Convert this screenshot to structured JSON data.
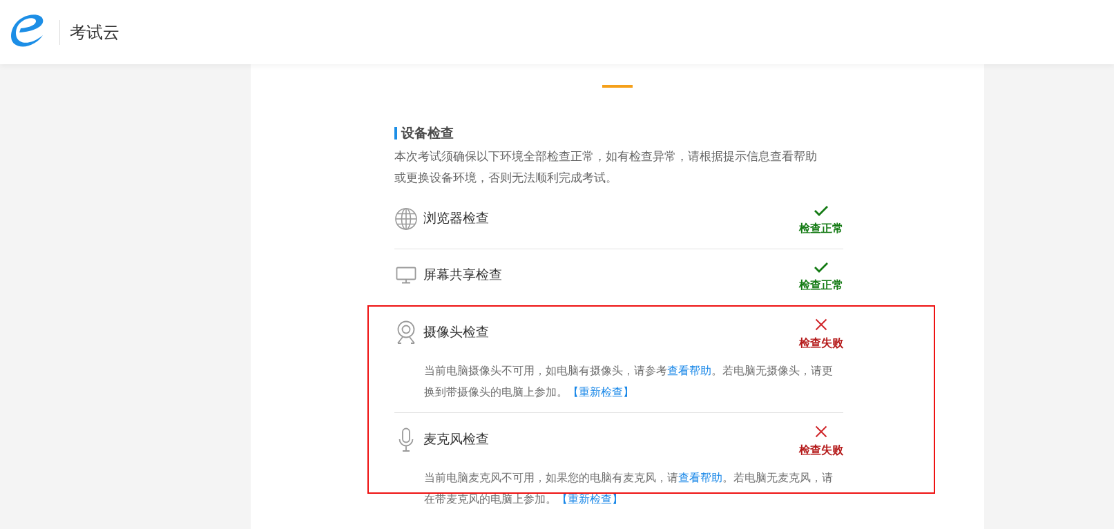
{
  "header": {
    "app_name": "考试云"
  },
  "section": {
    "title": "设备检查",
    "description": "本次考试须确保以下环境全部检查正常，如有检查异常，请根据提示信息查看帮助或更换设备环境，否则无法顺利完成考试。"
  },
  "highlight_frame": true,
  "checks": [
    {
      "kind": "browser",
      "name": "浏览器检查",
      "passed": true,
      "status_text": "检查正常"
    },
    {
      "kind": "screen",
      "name": "屏幕共享检查",
      "passed": true,
      "status_text": "检查正常"
    },
    {
      "kind": "camera",
      "name": "摄像头检查",
      "passed": false,
      "status_text": "检查失败",
      "detail": [
        {
          "kind": "text",
          "text": "当前电脑摄像头不可用，如电脑有摄像头，请参考"
        },
        {
          "kind": "link",
          "text": "查看帮助"
        },
        {
          "kind": "text",
          "text": "。若电脑无摄像头，请更换到带摄像头的电脑上参加。"
        },
        {
          "kind": "link",
          "text": "【重新检查】"
        }
      ]
    },
    {
      "kind": "microphone",
      "name": "麦克风检查",
      "passed": false,
      "status_text": "检查失败",
      "detail": [
        {
          "kind": "text",
          "text": "当前电脑麦克风不可用，如果您的电脑有麦克风，请"
        },
        {
          "kind": "link",
          "text": "查看帮助"
        },
        {
          "kind": "text",
          "text": "。若电脑无麦克风，请在带麦克风的电脑上参加。"
        },
        {
          "kind": "link",
          "text": "【重新检查】"
        }
      ]
    }
  ]
}
